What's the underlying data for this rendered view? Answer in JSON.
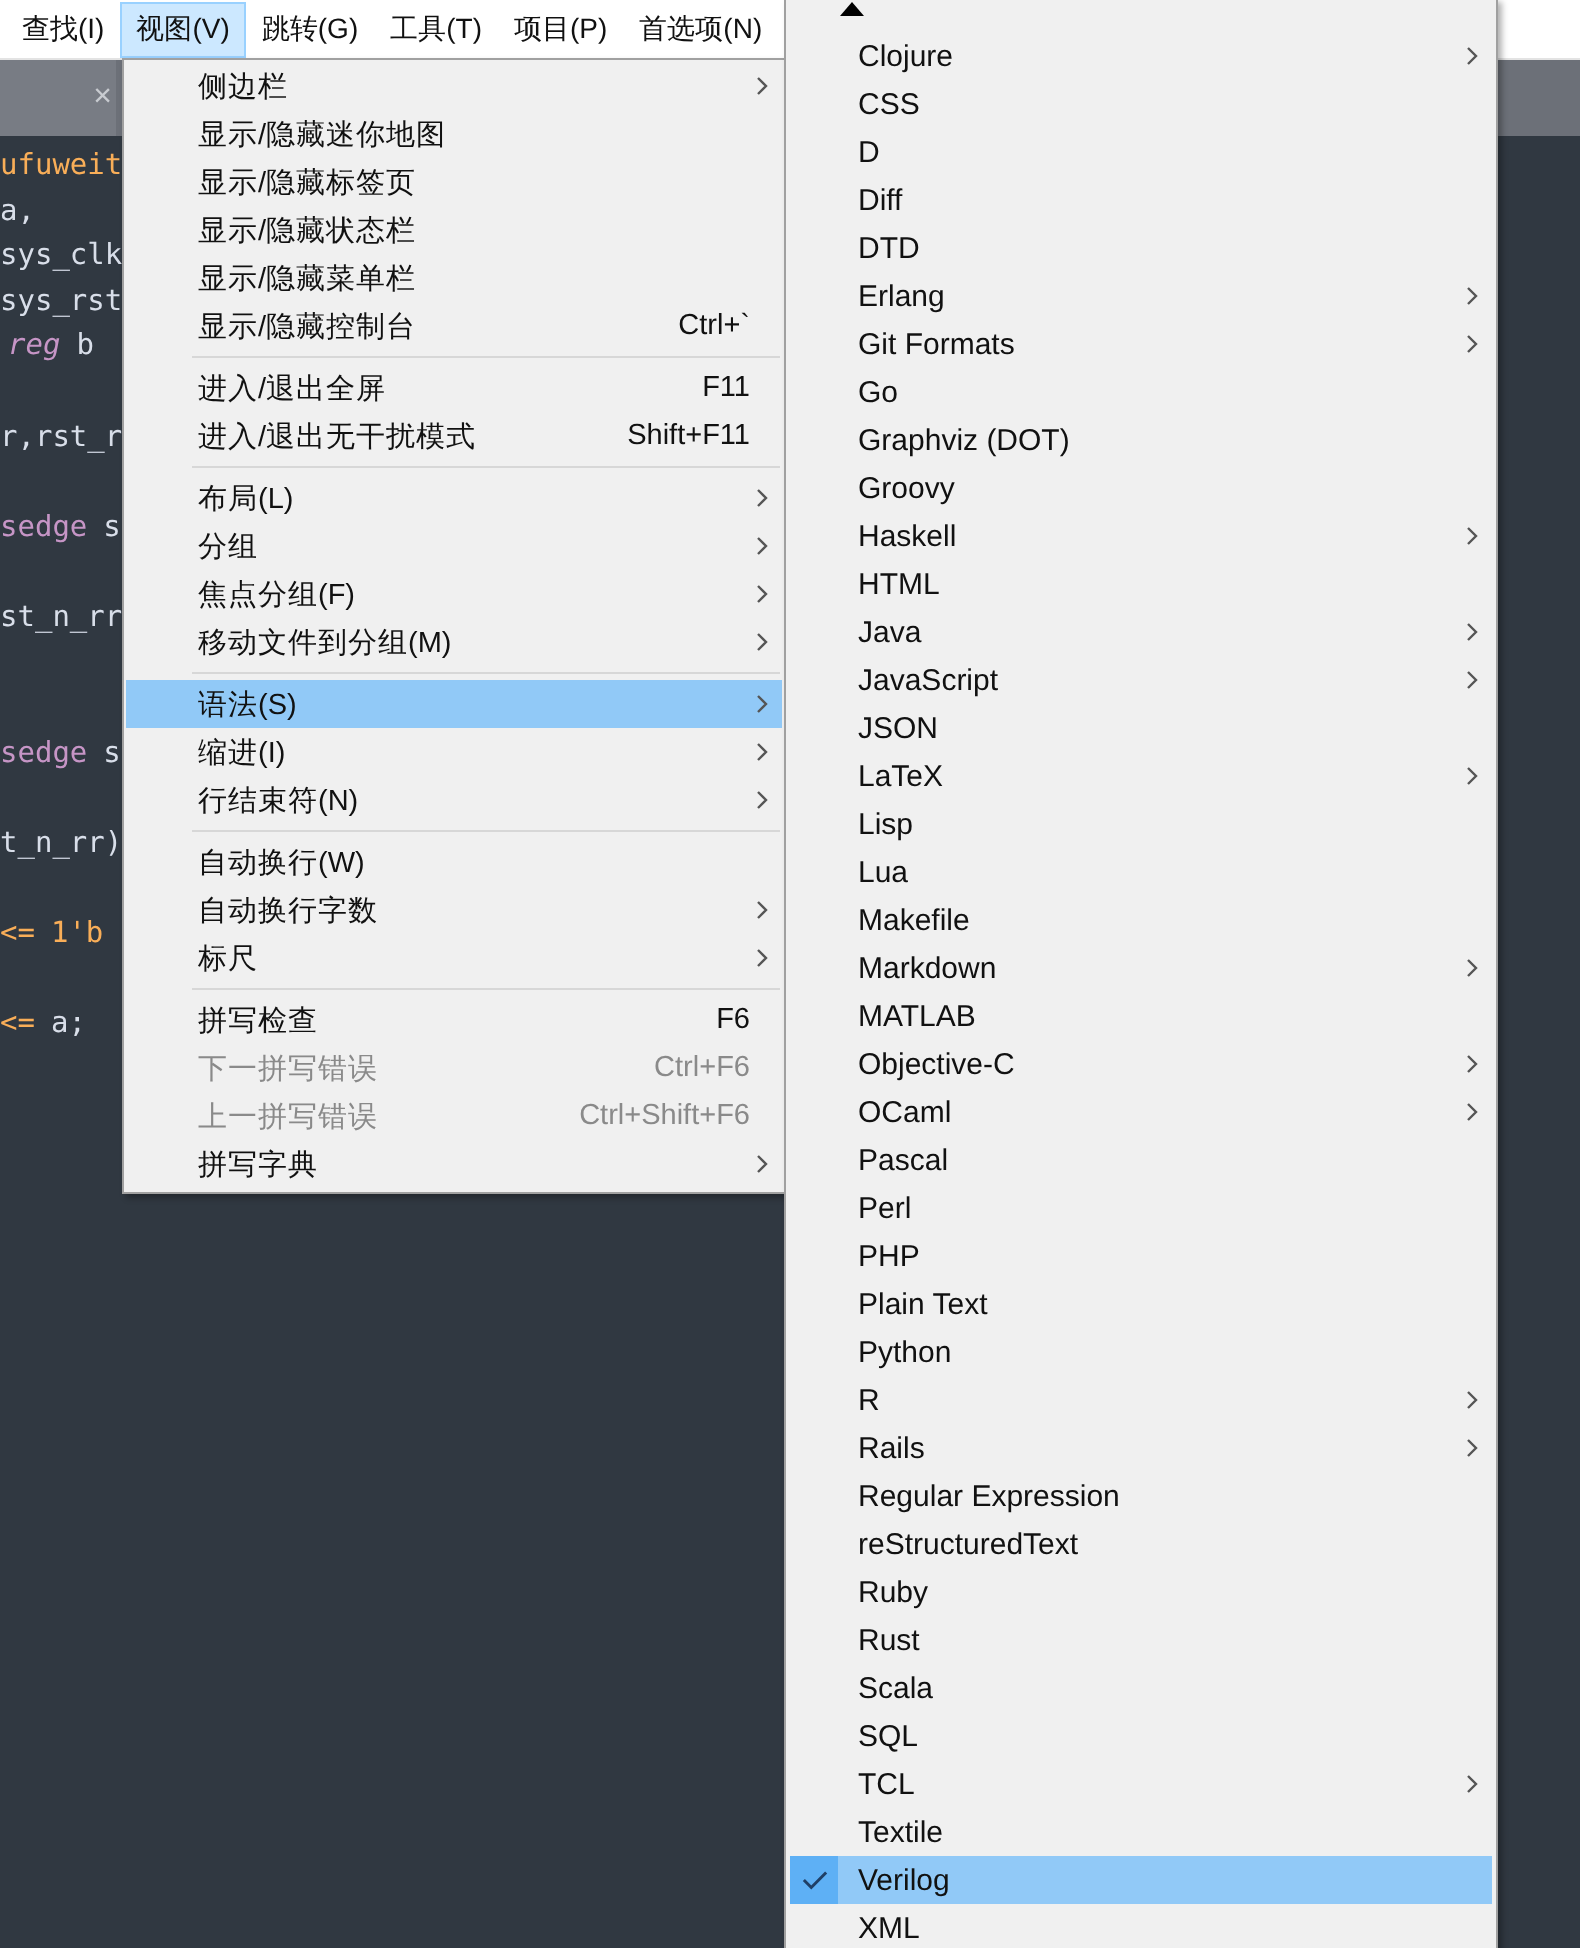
{
  "menu_bar": [
    {
      "label": "查找(I)",
      "selected": false
    },
    {
      "label": "视图(V)",
      "selected": true
    },
    {
      "label": "跳转(G)",
      "selected": false
    },
    {
      "label": "工具(T)",
      "selected": false
    },
    {
      "label": "项目(P)",
      "selected": false
    },
    {
      "label": "首选项(N)",
      "selected": false
    }
  ],
  "tab_bar": {
    "close": "×"
  },
  "editor_lines": [
    {
      "kind": "code",
      "segments": [
        {
          "text": "ufuweit",
          "kind": "string"
        }
      ]
    },
    {
      "kind": "code",
      "segments": [
        {
          "text": "a,",
          "kind": "plain"
        }
      ]
    },
    {
      "kind": "code",
      "segments": [
        {
          "text": "sys_clk",
          "kind": "plain"
        }
      ]
    },
    {
      "kind": "code",
      "segments": [
        {
          "text": "sys_rst",
          "kind": "plain"
        }
      ]
    },
    {
      "kind": "code",
      "segments": [
        {
          "text": "reg",
          "kind": "type"
        },
        {
          "text": "b",
          "kind": "plain"
        }
      ]
    },
    {
      "kind": "blank"
    },
    {
      "kind": "code",
      "segments": [
        {
          "text": "r,rst_r",
          "kind": "plain"
        }
      ]
    },
    {
      "kind": "blank"
    },
    {
      "kind": "code",
      "segments": [
        {
          "text": "sedge",
          "kind": "keyword"
        },
        {
          "text": "s",
          "kind": "plain"
        }
      ]
    },
    {
      "kind": "blank"
    },
    {
      "kind": "code",
      "segments": [
        {
          "text": "st_n_rr",
          "kind": "plain"
        }
      ]
    },
    {
      "kind": "blank"
    },
    {
      "kind": "blank"
    },
    {
      "kind": "code",
      "segments": [
        {
          "text": "sedge",
          "kind": "keyword"
        },
        {
          "text": "s",
          "kind": "plain"
        }
      ]
    },
    {
      "kind": "blank"
    },
    {
      "kind": "code",
      "segments": [
        {
          "text": "t_n_rr)",
          "kind": "plain"
        }
      ]
    },
    {
      "kind": "blank"
    },
    {
      "kind": "code",
      "segments": [
        {
          "text": "<=",
          "kind": "operator"
        },
        {
          "text": "1'b",
          "kind": "string"
        }
      ]
    },
    {
      "kind": "blank"
    },
    {
      "kind": "code",
      "segments": [
        {
          "text": "<=",
          "kind": "operator"
        },
        {
          "text": "a;",
          "kind": "plain"
        }
      ]
    }
  ],
  "view_menu": [
    {
      "kind": "item",
      "label": "侧边栏",
      "submenu": true,
      "selected": false,
      "disabled": false
    },
    {
      "kind": "item",
      "label": "显示/隐藏迷你地图",
      "selected": false,
      "disabled": false
    },
    {
      "kind": "item",
      "label": "显示/隐藏标签页",
      "selected": false,
      "disabled": false
    },
    {
      "kind": "item",
      "label": "显示/隐藏状态栏",
      "selected": false,
      "disabled": false
    },
    {
      "kind": "item",
      "label": "显示/隐藏菜单栏",
      "selected": false,
      "disabled": false
    },
    {
      "kind": "item",
      "label": "显示/隐藏控制台",
      "shortcut": "Ctrl+`",
      "selected": false,
      "disabled": false
    },
    {
      "kind": "separator"
    },
    {
      "kind": "item",
      "label": "进入/退出全屏",
      "shortcut": "F11",
      "selected": false,
      "disabled": false
    },
    {
      "kind": "item",
      "label": "进入/退出无干扰模式",
      "shortcut": "Shift+F11",
      "selected": false,
      "disabled": false
    },
    {
      "kind": "separator"
    },
    {
      "kind": "item",
      "label": "布局(L)",
      "submenu": true,
      "selected": false,
      "disabled": false
    },
    {
      "kind": "item",
      "label": "分组",
      "submenu": true,
      "selected": false,
      "disabled": false
    },
    {
      "kind": "item",
      "label": "焦点分组(F)",
      "submenu": true,
      "selected": false,
      "disabled": false
    },
    {
      "kind": "item",
      "label": "移动文件到分组(M)",
      "submenu": true,
      "selected": false,
      "disabled": false
    },
    {
      "kind": "separator"
    },
    {
      "kind": "item",
      "label": "语法(S)",
      "submenu": true,
      "selected": true,
      "disabled": false
    },
    {
      "kind": "item",
      "label": "缩进(I)",
      "submenu": true,
      "selected": false,
      "disabled": false
    },
    {
      "kind": "item",
      "label": "行结束符(N)",
      "submenu": true,
      "selected": false,
      "disabled": false
    },
    {
      "kind": "separator"
    },
    {
      "kind": "item",
      "label": "自动换行(W)",
      "selected": false,
      "disabled": false
    },
    {
      "kind": "item",
      "label": "自动换行字数",
      "submenu": true,
      "selected": false,
      "disabled": false
    },
    {
      "kind": "item",
      "label": "标尺",
      "submenu": true,
      "selected": false,
      "disabled": false
    },
    {
      "kind": "separator"
    },
    {
      "kind": "item",
      "label": "拼写检查",
      "shortcut": "F6",
      "selected": false,
      "disabled": false
    },
    {
      "kind": "item",
      "label": "下一拼写错误",
      "shortcut": "Ctrl+F6",
      "selected": false,
      "disabled": true
    },
    {
      "kind": "item",
      "label": "上一拼写错误",
      "shortcut": "Ctrl+Shift+F6",
      "selected": false,
      "disabled": true
    },
    {
      "kind": "item",
      "label": "拼写字典",
      "submenu": true,
      "selected": false,
      "disabled": false
    }
  ],
  "syntax_menu": [
    {
      "label": "Clojure",
      "submenu": true,
      "checked": false,
      "selected": false
    },
    {
      "label": "CSS",
      "checked": false,
      "selected": false
    },
    {
      "label": "D",
      "checked": false,
      "selected": false
    },
    {
      "label": "Diff",
      "checked": false,
      "selected": false
    },
    {
      "label": "DTD",
      "checked": false,
      "selected": false
    },
    {
      "label": "Erlang",
      "submenu": true,
      "checked": false,
      "selected": false
    },
    {
      "label": "Git Formats",
      "submenu": true,
      "checked": false,
      "selected": false
    },
    {
      "label": "Go",
      "checked": false,
      "selected": false
    },
    {
      "label": "Graphviz (DOT)",
      "checked": false,
      "selected": false
    },
    {
      "label": "Groovy",
      "checked": false,
      "selected": false
    },
    {
      "label": "Haskell",
      "submenu": true,
      "checked": false,
      "selected": false
    },
    {
      "label": "HTML",
      "checked": false,
      "selected": false
    },
    {
      "label": "Java",
      "submenu": true,
      "checked": false,
      "selected": false
    },
    {
      "label": "JavaScript",
      "submenu": true,
      "checked": false,
      "selected": false
    },
    {
      "label": "JSON",
      "checked": false,
      "selected": false
    },
    {
      "label": "LaTeX",
      "submenu": true,
      "checked": false,
      "selected": false
    },
    {
      "label": "Lisp",
      "checked": false,
      "selected": false
    },
    {
      "label": "Lua",
      "checked": false,
      "selected": false
    },
    {
      "label": "Makefile",
      "checked": false,
      "selected": false
    },
    {
      "label": "Markdown",
      "submenu": true,
      "checked": false,
      "selected": false
    },
    {
      "label": "MATLAB",
      "checked": false,
      "selected": false
    },
    {
      "label": "Objective-C",
      "submenu": true,
      "checked": false,
      "selected": false
    },
    {
      "label": "OCaml",
      "submenu": true,
      "checked": false,
      "selected": false
    },
    {
      "label": "Pascal",
      "checked": false,
      "selected": false
    },
    {
      "label": "Perl",
      "checked": false,
      "selected": false
    },
    {
      "label": "PHP",
      "checked": false,
      "selected": false
    },
    {
      "label": "Plain Text",
      "checked": false,
      "selected": false
    },
    {
      "label": "Python",
      "checked": false,
      "selected": false
    },
    {
      "label": "R",
      "submenu": true,
      "checked": false,
      "selected": false
    },
    {
      "label": "Rails",
      "submenu": true,
      "checked": false,
      "selected": false
    },
    {
      "label": "Regular Expression",
      "checked": false,
      "selected": false
    },
    {
      "label": "reStructuredText",
      "checked": false,
      "selected": false
    },
    {
      "label": "Ruby",
      "checked": false,
      "selected": false
    },
    {
      "label": "Rust",
      "checked": false,
      "selected": false
    },
    {
      "label": "Scala",
      "checked": false,
      "selected": false
    },
    {
      "label": "SQL",
      "checked": false,
      "selected": false
    },
    {
      "label": "TCL",
      "submenu": true,
      "checked": false,
      "selected": false
    },
    {
      "label": "Textile",
      "checked": false,
      "selected": false
    },
    {
      "label": "Verilog",
      "checked": true,
      "selected": true
    },
    {
      "label": "XML",
      "checked": false,
      "selected": false
    }
  ]
}
